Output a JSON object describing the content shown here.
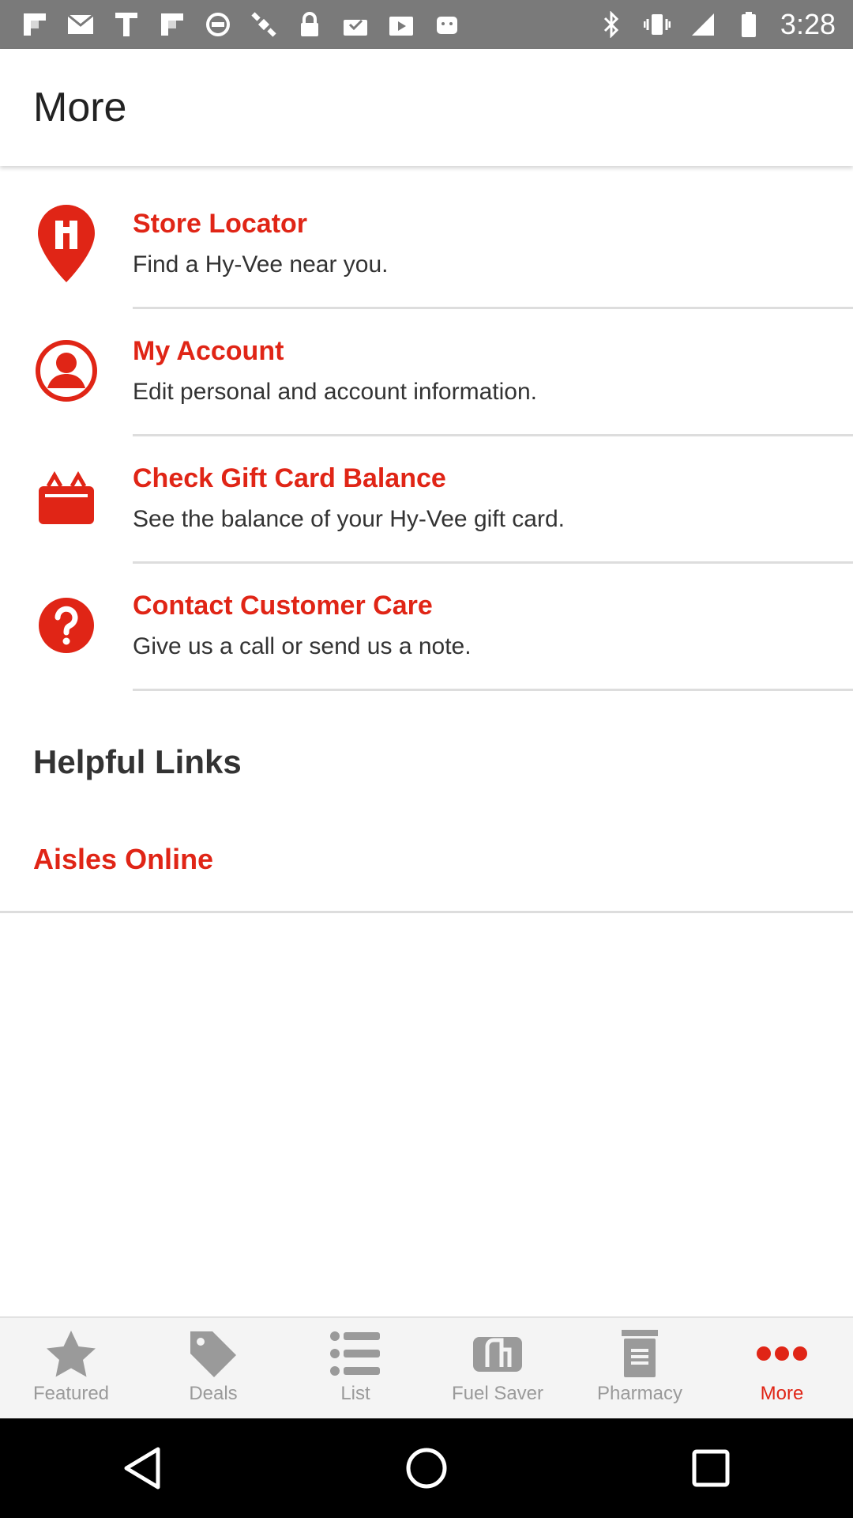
{
  "status_bar": {
    "time": "3:28",
    "left_icons": [
      "flipboard-icon",
      "mail-icon",
      "text-icon",
      "flipboard-icon",
      "vpn-icon",
      "satellite-icon",
      "lock-icon",
      "download-icon",
      "play-store-icon",
      "android-icon"
    ],
    "right_icons": [
      "bluetooth-icon",
      "vibrate-icon",
      "signal-icon",
      "battery-icon"
    ]
  },
  "header": {
    "title": "More"
  },
  "menu": {
    "items": [
      {
        "icon": "location-pin-icon",
        "title": "Store Locator",
        "description": "Find a Hy-Vee near you."
      },
      {
        "icon": "account-icon",
        "title": "My Account",
        "description": "Edit personal and account information."
      },
      {
        "icon": "gift-card-icon",
        "title": "Check Gift Card Balance",
        "description": "See the balance of your Hy-Vee gift card."
      },
      {
        "icon": "help-icon",
        "title": "Contact Customer Care",
        "description": "Give us a call or send us a note."
      }
    ]
  },
  "helpful_links": {
    "title": "Helpful Links",
    "links": [
      {
        "label": "Aisles Online"
      }
    ]
  },
  "tab_bar": {
    "active": "More",
    "tabs": [
      {
        "label": "Featured",
        "icon": "star-icon"
      },
      {
        "label": "Deals",
        "icon": "tag-icon"
      },
      {
        "label": "List",
        "icon": "list-icon"
      },
      {
        "label": "Fuel Saver",
        "icon": "fuel-icon"
      },
      {
        "label": "Pharmacy",
        "icon": "pharmacy-icon"
      },
      {
        "label": "More",
        "icon": "more-dots-icon"
      }
    ]
  },
  "nav_bar": {
    "buttons": [
      "back-icon",
      "home-icon",
      "recents-icon"
    ]
  },
  "colors": {
    "accent": "#e02516",
    "status_bar": "#7a7a7a",
    "tab_inactive": "#9a9a9a",
    "divider": "#dddddd"
  }
}
